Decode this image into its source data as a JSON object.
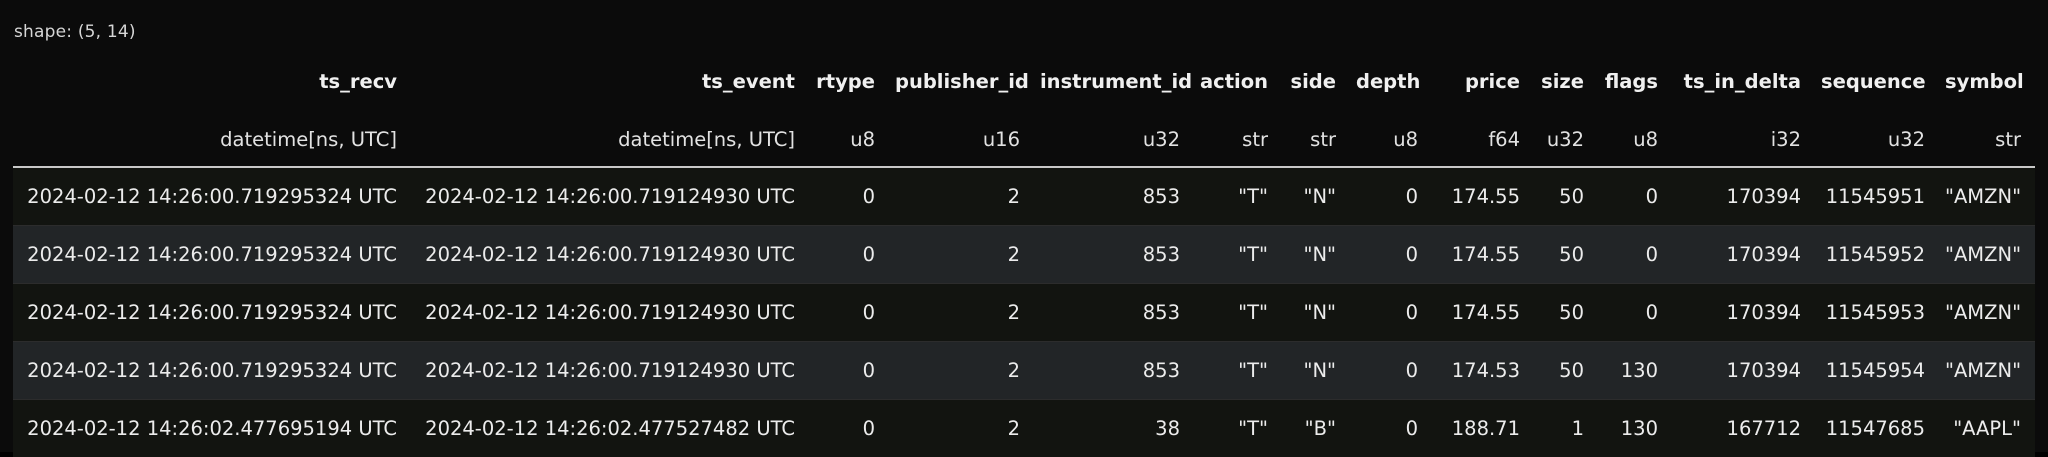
{
  "shape": "shape: (5, 14)",
  "columns": [
    {
      "name": "ts_recv",
      "dtype": "datetime[ns, UTC]"
    },
    {
      "name": "ts_event",
      "dtype": "datetime[ns, UTC]"
    },
    {
      "name": "rtype",
      "dtype": "u8"
    },
    {
      "name": "publisher_id",
      "dtype": "u16"
    },
    {
      "name": "instrument_id",
      "dtype": "u32"
    },
    {
      "name": "action",
      "dtype": "str"
    },
    {
      "name": "side",
      "dtype": "str"
    },
    {
      "name": "depth",
      "dtype": "u8"
    },
    {
      "name": "price",
      "dtype": "f64"
    },
    {
      "name": "size",
      "dtype": "u32"
    },
    {
      "name": "flags",
      "dtype": "u8"
    },
    {
      "name": "ts_in_delta",
      "dtype": "i32"
    },
    {
      "name": "sequence",
      "dtype": "u32"
    },
    {
      "name": "symbol",
      "dtype": "str"
    }
  ],
  "rows": [
    [
      "2024-02-12 14:26:00.719295324 UTC",
      "2024-02-12 14:26:00.719124930 UTC",
      "0",
      "2",
      "853",
      "\"T\"",
      "\"N\"",
      "0",
      "174.55",
      "50",
      "0",
      "170394",
      "11545951",
      "\"AMZN\""
    ],
    [
      "2024-02-12 14:26:00.719295324 UTC",
      "2024-02-12 14:26:00.719124930 UTC",
      "0",
      "2",
      "853",
      "\"T\"",
      "\"N\"",
      "0",
      "174.55",
      "50",
      "0",
      "170394",
      "11545952",
      "\"AMZN\""
    ],
    [
      "2024-02-12 14:26:00.719295324 UTC",
      "2024-02-12 14:26:00.719124930 UTC",
      "0",
      "2",
      "853",
      "\"T\"",
      "\"N\"",
      "0",
      "174.55",
      "50",
      "0",
      "170394",
      "11545953",
      "\"AMZN\""
    ],
    [
      "2024-02-12 14:26:00.719295324 UTC",
      "2024-02-12 14:26:00.719124930 UTC",
      "0",
      "2",
      "853",
      "\"T\"",
      "\"N\"",
      "0",
      "174.53",
      "50",
      "130",
      "170394",
      "11545954",
      "\"AMZN\""
    ],
    [
      "2024-02-12 14:26:02.477695194 UTC",
      "2024-02-12 14:26:02.477527482 UTC",
      "0",
      "2",
      "38",
      "\"T\"",
      "\"B\"",
      "0",
      "188.71",
      "1",
      "130",
      "167712",
      "11547685",
      "\"AAPL\""
    ]
  ]
}
